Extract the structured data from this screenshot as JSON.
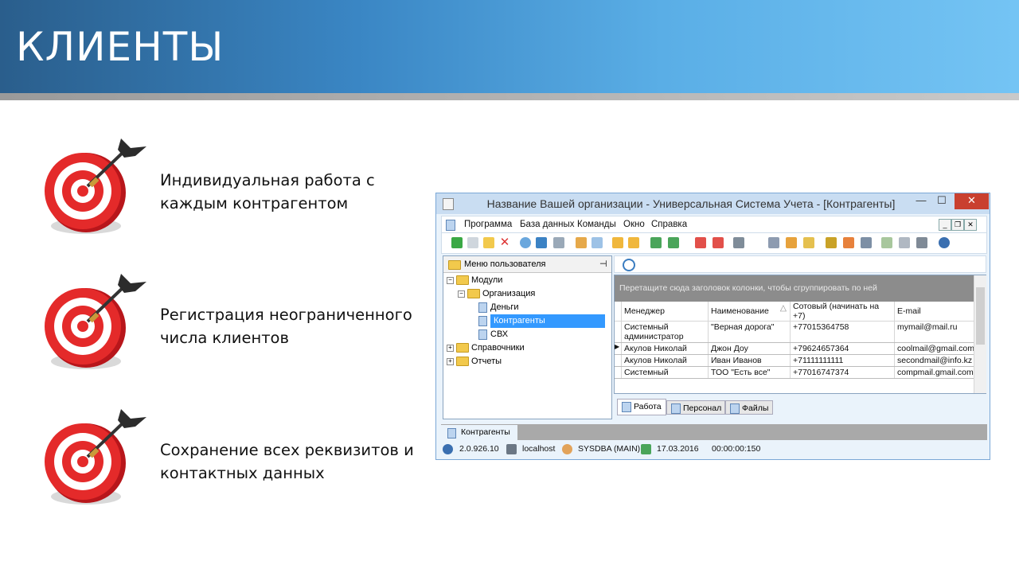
{
  "slide": {
    "title": "КЛИЕНТЫ",
    "bullets": [
      {
        "icon": "target-icon",
        "text": "Индивидуальная работа с каждым контрагентом"
      },
      {
        "icon": "target-icon",
        "text": "Регистрация неограниченного числа клиентов"
      },
      {
        "icon": "target-icon",
        "text": "Сохранение всех реквизитов и контактных данных"
      }
    ]
  },
  "window": {
    "title": "Название Вашей организации - Универсальная Система Учета - [Контрагенты]",
    "controls": {
      "minimize": "—",
      "maximize": "☐",
      "close": "✕"
    },
    "menu": [
      "Программа",
      "База данных",
      "Команды",
      "Окно",
      "Справка"
    ],
    "mdi_controls": [
      "_",
      "❐",
      "✕"
    ],
    "left_panel": {
      "title": "Меню пользователя",
      "pin": "⊣",
      "tree": [
        {
          "label": "Модули",
          "level": 0,
          "expander": "−",
          "type": "folder"
        },
        {
          "label": "Организация",
          "level": 1,
          "expander": "−",
          "type": "folder"
        },
        {
          "label": "Деньги",
          "level": 2,
          "type": "doc"
        },
        {
          "label": "Контрагенты",
          "level": 2,
          "type": "doc",
          "selected": true
        },
        {
          "label": "СВХ",
          "level": 2,
          "type": "doc"
        },
        {
          "label": "Справочники",
          "level": 0,
          "expander": "+",
          "type": "folder"
        },
        {
          "label": "Отчеты",
          "level": 0,
          "expander": "+",
          "type": "folder"
        }
      ]
    },
    "grid": {
      "group_hint": "Перетащите сюда заголовок колонки, чтобы сгруппировать по ней",
      "sort_indicator": "△",
      "columns": [
        "Менеджер",
        "Наименование",
        "Сотовый (начинать на +7)",
        "E-mail"
      ],
      "rows": [
        {
          "current": false,
          "cells": [
            "Системный администратор",
            "\"Верная дорога\"",
            "+77015364758",
            "mymail@mail.ru"
          ]
        },
        {
          "current": true,
          "cells": [
            "Акулов Николай",
            "Джон Доу",
            "+79624657364",
            "coolmail@gmail.com"
          ]
        },
        {
          "current": false,
          "cells": [
            "Акулов Николай",
            "Иван Иванов",
            "+71111111111",
            "secondmail@info.kz"
          ]
        },
        {
          "current": false,
          "cells": [
            "Системный",
            "ТОО \"Есть все\"",
            "+77016747374",
            "compmail.gmail.com"
          ]
        }
      ],
      "row_indicator": "▶"
    },
    "tabs": [
      "Работа",
      "Персонал",
      "Файлы"
    ],
    "document_tab": "Контрагенты",
    "status": {
      "version": "2.0.926.10",
      "server": "localhost",
      "user": "SYSDBA (MAIN)",
      "date": "17.03.2016",
      "timer": "00:00:00:150"
    }
  }
}
